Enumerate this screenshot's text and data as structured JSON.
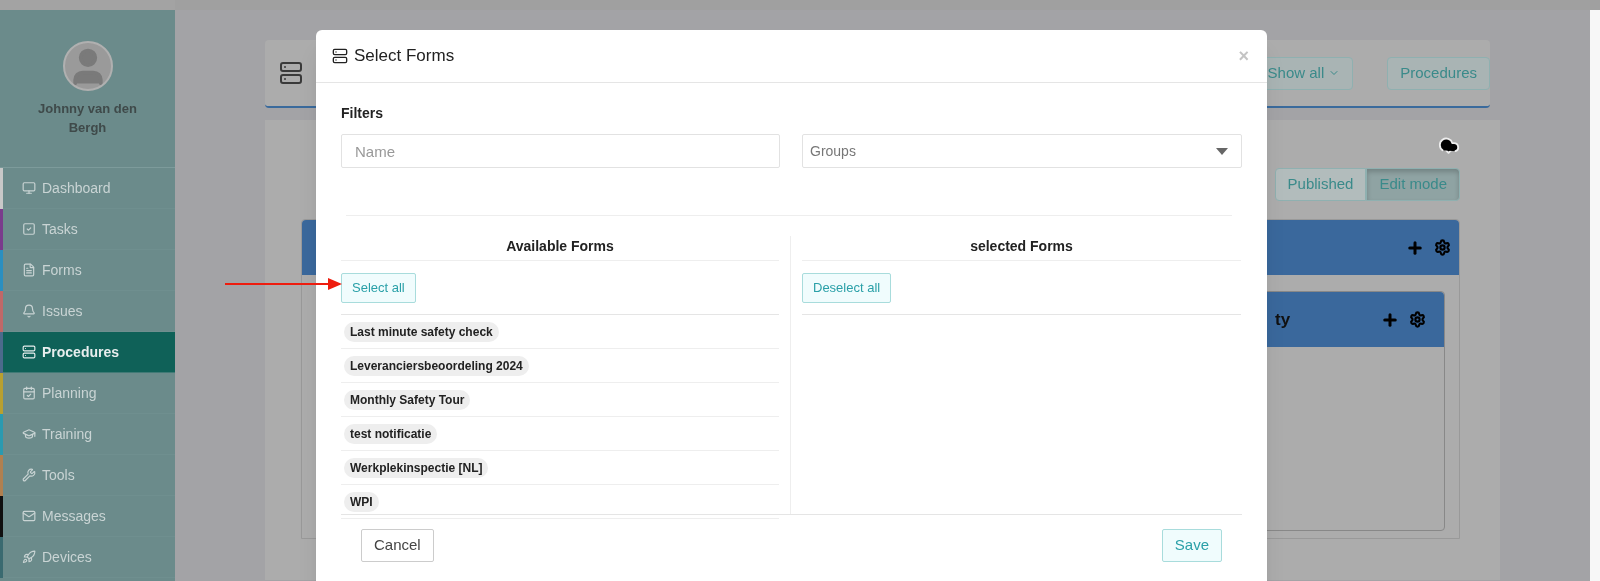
{
  "sidebar": {
    "user_name": "Johnny van den Bergh",
    "items": [
      {
        "label": "Dashboard",
        "selected": false,
        "color": "#c8c8c8"
      },
      {
        "label": "Tasks",
        "selected": false,
        "color": "#7a3b8c"
      },
      {
        "label": "Forms",
        "selected": false,
        "color": "#2a8fc0"
      },
      {
        "label": "Issues",
        "selected": false,
        "color": "#c06868"
      },
      {
        "label": "Procedures",
        "selected": true,
        "color": "#4c6a8c"
      },
      {
        "label": "Planning",
        "selected": false,
        "color": "#b8a030"
      },
      {
        "label": "Training",
        "selected": false,
        "color": "#2a9ab0"
      },
      {
        "label": "Tools",
        "selected": false,
        "color": "#b08050"
      },
      {
        "label": "Messages",
        "selected": false,
        "color": "#101010"
      },
      {
        "label": "Devices",
        "selected": false,
        "color": "#3a6a70"
      }
    ]
  },
  "background": {
    "header_buttons": [
      {
        "label": "Show all",
        "kind": "dropdown"
      },
      {
        "label": "Procedures",
        "kind": "button"
      }
    ],
    "mode_toggle": [
      {
        "label": "Published",
        "selected": false
      },
      {
        "label": "Edit mode",
        "selected": true
      }
    ],
    "panel_title": "ty"
  },
  "dialog": {
    "title": "Select Forms",
    "close": "×",
    "filters_label": "Filters",
    "name_placeholder": "Name",
    "groups_placeholder": "Groups",
    "available": {
      "title": "Available Forms",
      "button": "Select all",
      "items": [
        "Last minute safety check",
        "Leveranciersbeoordeling 2024",
        "Monthly Safety Tour",
        "test notificatie",
        "Werkplekinspectie [NL]",
        "WPI"
      ]
    },
    "selected": {
      "title": "selected Forms",
      "button": "Deselect all"
    },
    "buttons": [
      {
        "label": "Cancel",
        "kind": "secondary"
      },
      {
        "label": "Save",
        "kind": "primary"
      }
    ]
  }
}
